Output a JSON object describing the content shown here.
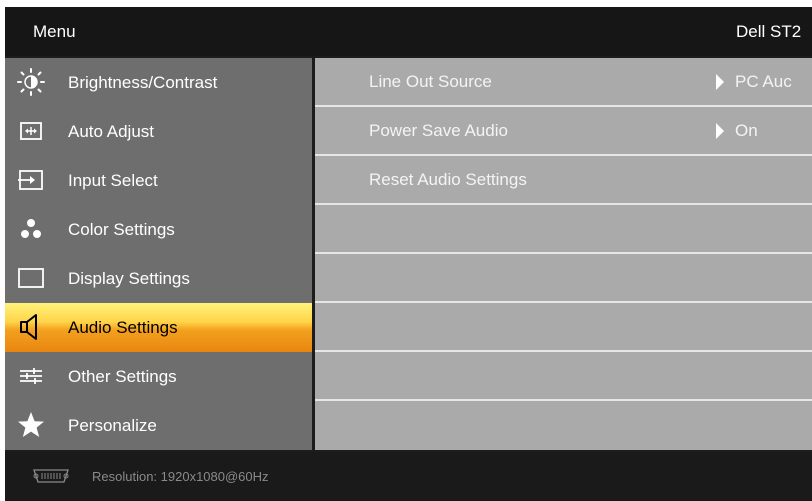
{
  "header": {
    "title": "Menu",
    "model": "Dell ST2"
  },
  "menu": {
    "items": [
      {
        "label": "Brightness/Contrast",
        "icon": "brightness-icon",
        "selected": false
      },
      {
        "label": "Auto Adjust",
        "icon": "auto-adjust-icon",
        "selected": false
      },
      {
        "label": "Input Select",
        "icon": "input-select-icon",
        "selected": false
      },
      {
        "label": "Color Settings",
        "icon": "color-settings-icon",
        "selected": false
      },
      {
        "label": "Display Settings",
        "icon": "display-settings-icon",
        "selected": false
      },
      {
        "label": "Audio Settings",
        "icon": "speaker-icon",
        "selected": true
      },
      {
        "label": "Other Settings",
        "icon": "other-settings-icon",
        "selected": false
      },
      {
        "label": "Personalize",
        "icon": "star-icon",
        "selected": false
      }
    ]
  },
  "panel": {
    "rows": [
      {
        "label": "Line Out Source",
        "value": "PC Auc"
      },
      {
        "label": "Power Save Audio",
        "value": "On"
      },
      {
        "label": "Reset Audio Settings",
        "value": ""
      },
      {
        "label": "",
        "value": ""
      },
      {
        "label": "",
        "value": ""
      },
      {
        "label": "",
        "value": ""
      },
      {
        "label": "",
        "value": ""
      },
      {
        "label": "",
        "value": ""
      }
    ]
  },
  "footer": {
    "resolution": "Resolution:  1920x1080@60Hz",
    "connector_icon": "vga-connector-icon"
  },
  "colors": {
    "menu_bg": "#6e6e6e",
    "panel_bg": "#aaaaaa",
    "selected_top": "#fff27a",
    "selected_bottom": "#e88610",
    "frame_bg": "#1c1c1c"
  }
}
